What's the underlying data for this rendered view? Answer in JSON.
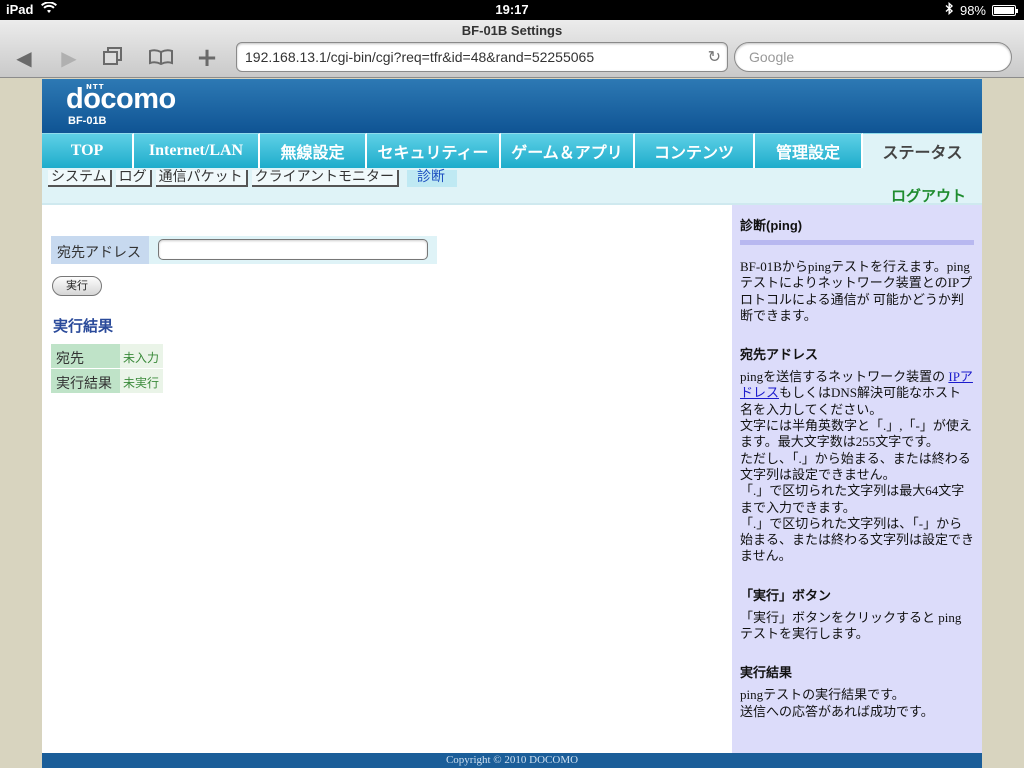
{
  "statusbar": {
    "device": "iPad",
    "time": "19:17",
    "battery": "98%",
    "battery_level": 0.98
  },
  "browser": {
    "window_title": "BF-01B Settings",
    "url": "192.168.13.1/cgi-bin/cgi?req=tfr&id=48&rand=52255065",
    "search_placeholder": "Google"
  },
  "brand": {
    "company_small": "NTT",
    "logo": "docomo",
    "model": "BF-01B"
  },
  "tabs": [
    {
      "label": "TOP",
      "active": false
    },
    {
      "label": "Internet/LAN",
      "active": false
    },
    {
      "label": "無線設定",
      "active": false
    },
    {
      "label": "セキュリティー",
      "active": false
    },
    {
      "label": "ゲーム＆アプリ",
      "active": false
    },
    {
      "label": "コンテンツ",
      "active": false
    },
    {
      "label": "管理設定",
      "active": false
    },
    {
      "label": "ステータス",
      "active": true
    }
  ],
  "subnav": {
    "items": [
      "システム",
      "ログ",
      "通信パケット",
      "クライアントモニター",
      "診断"
    ],
    "active_index": 4,
    "logout": "ログアウト"
  },
  "form": {
    "address_label": "宛先アドレス",
    "address_value": "",
    "exec_button": "実行"
  },
  "results": {
    "title": "実行結果",
    "rows": [
      {
        "key": "宛先",
        "value": "未入力"
      },
      {
        "key": "実行結果",
        "value": "未実行"
      }
    ]
  },
  "help": {
    "title": "診断(ping)",
    "intro": "BF-01Bからpingテストを行えます。pingテストによりネットワーク装置とのIPプロトコルによる通信が 可能かどうか判断できます。",
    "address_heading": "宛先アドレス",
    "address_text_before": "pingを送信するネットワーク装置の ",
    "address_link": "IPアドレス",
    "address_text_after": "もしくはDNS解決可能なホスト名を入力してください。",
    "address_rule1": "文字には半角英数字と「.」,「-」が使えます。最大文字数は255文字です。",
    "address_rule2": "ただし、「.」から始まる、または終わる文字列は設定できません。",
    "address_rule3": "「.」で区切られた文字列は最大64文字まで入力できます。",
    "address_rule4": "「.」で区切られた文字列は、「-」から始まる、または終わる文字列は設定できません。",
    "exec_heading": "「実行」ボタン",
    "exec_text": "「実行」ボタンをクリックすると pingテストを実行します。",
    "result_heading": "実行結果",
    "result_text1": "pingテストの実行結果です。",
    "result_text2": "送信への応答があれば成功です。"
  },
  "footer": {
    "copyright": "Copyright © 2010 DOCOMO"
  }
}
